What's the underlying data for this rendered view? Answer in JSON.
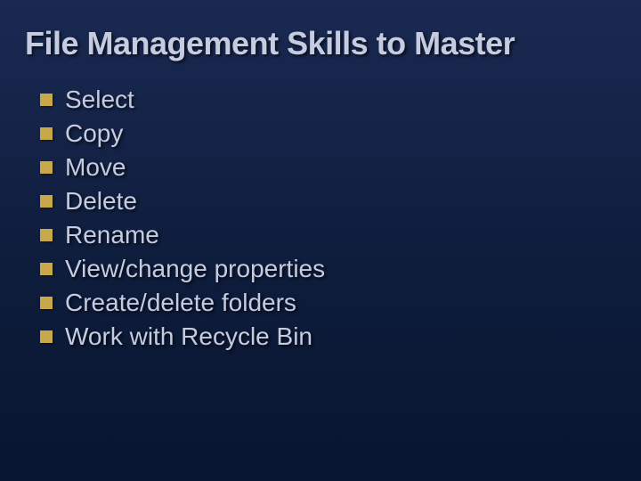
{
  "slide": {
    "title": "File Management Skills to Master",
    "bullets": [
      "Select",
      "Copy",
      "Move",
      "Delete",
      "Rename",
      "View/change properties",
      "Create/delete folders",
      "Work with Recycle Bin"
    ]
  }
}
